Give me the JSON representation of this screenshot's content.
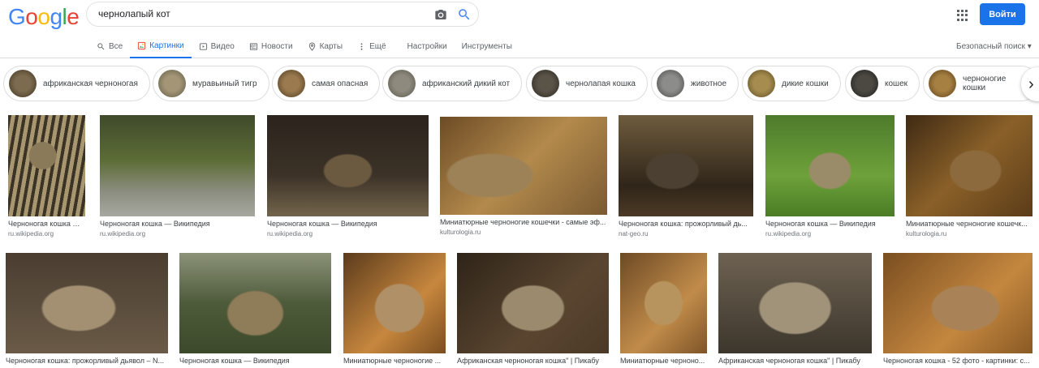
{
  "logo": {
    "letters": [
      {
        "char": "G",
        "color": "#4285f4"
      },
      {
        "char": "o",
        "color": "#ea4335"
      },
      {
        "char": "o",
        "color": "#fbbc05"
      },
      {
        "char": "g",
        "color": "#4285f4"
      },
      {
        "char": "l",
        "color": "#34a853"
      },
      {
        "char": "e",
        "color": "#ea4335"
      }
    ]
  },
  "search": {
    "query": "чернолапый кот",
    "camera_icon": "camera-icon",
    "search_icon": "search-icon"
  },
  "header": {
    "apps_icon": "apps-grid-icon",
    "signin_label": "Войти",
    "accent": "#1a73e8"
  },
  "tabs": [
    {
      "label": "Все",
      "icon": "search-icon",
      "active": false
    },
    {
      "label": "Картинки",
      "icon": "image-icon",
      "active": true
    },
    {
      "label": "Видео",
      "icon": "play-icon",
      "active": false
    },
    {
      "label": "Новости",
      "icon": "news-icon",
      "active": false
    },
    {
      "label": "Карты",
      "icon": "pin-icon",
      "active": false
    },
    {
      "label": "Ещё",
      "icon": "more-vert-icon",
      "active": false
    },
    {
      "label": "Настройки",
      "icon": "",
      "active": false
    },
    {
      "label": "Инструменты",
      "icon": "",
      "active": false
    }
  ],
  "safe_search": "Безопасный поиск ▾",
  "chips": [
    {
      "label": "африканская черноногая"
    },
    {
      "label": "муравьиный тигр"
    },
    {
      "label": "самая опасная"
    },
    {
      "label": "африканский дикий кот"
    },
    {
      "label": "чернолапая кошка"
    },
    {
      "label": "животное"
    },
    {
      "label": "дикие кошки"
    },
    {
      "label": "кошек"
    },
    {
      "label": "черноногие кошки"
    }
  ],
  "next_arrow": "›",
  "results_row1": [
    {
      "title": "Черноногая кошка — ...",
      "source": "ru.wikipedia.org"
    },
    {
      "title": "Черноногая кошка — Википедия",
      "source": "ru.wikipedia.org"
    },
    {
      "title": "Черноногая кошка — Википедия",
      "source": "ru.wikipedia.org"
    },
    {
      "title": "Миниатюрные черноногие кошечки - самые эф...",
      "source": "kulturologia.ru"
    },
    {
      "title": "Черноногая кошка: прожорливый дь...",
      "source": "nat-geo.ru"
    },
    {
      "title": "Черноногая кошка — Википедия",
      "source": "ru.wikipedia.org"
    },
    {
      "title": "Миниатюрные черноногие кошечк...",
      "source": "kulturologia.ru"
    }
  ],
  "results_row2": [
    {
      "title": "Черноногая кошка: прожорливый дьявол – N..."
    },
    {
      "title": "Черноногая кошка — Википедия"
    },
    {
      "title": "Миниатюрные черноногие ..."
    },
    {
      "title": "Африканская черноногая кошка\" | Пикабу"
    },
    {
      "title": "Миниатюрные черноно..."
    },
    {
      "title": "Африканская черноногая кошка\" | Пикабу"
    },
    {
      "title": "Черноногая кошка - 52 фото - картинки: с..."
    }
  ]
}
